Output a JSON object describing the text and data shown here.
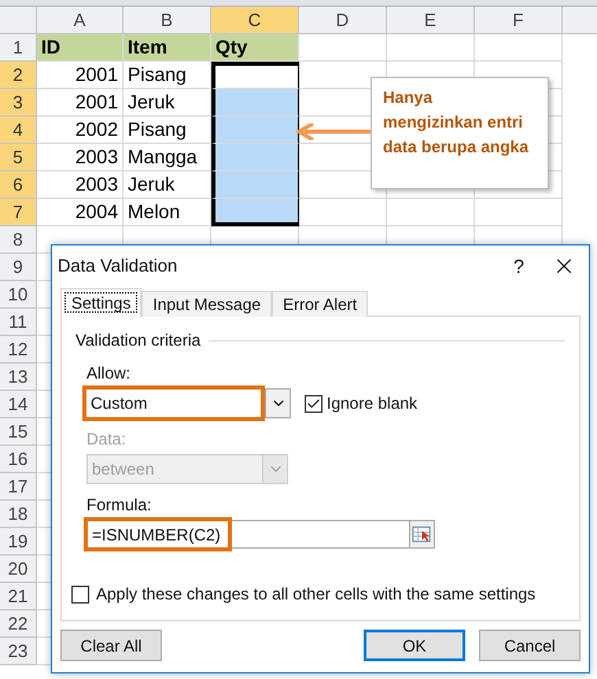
{
  "sheet": {
    "columns": [
      {
        "label": "A",
        "selected": false
      },
      {
        "label": "B",
        "selected": false
      },
      {
        "label": "C",
        "selected": true
      },
      {
        "label": "D",
        "selected": false
      },
      {
        "label": "E",
        "selected": false
      },
      {
        "label": "F",
        "selected": false
      }
    ],
    "header_row": {
      "label": "1",
      "cells": [
        "ID",
        "Item",
        "Qty"
      ]
    },
    "rows": [
      {
        "label": "2",
        "selected": true,
        "active": true,
        "id": "2001",
        "item": "Pisang"
      },
      {
        "label": "3",
        "selected": true,
        "active": false,
        "id": "2001",
        "item": "Jeruk"
      },
      {
        "label": "4",
        "selected": true,
        "active": false,
        "id": "2002",
        "item": "Pisang"
      },
      {
        "label": "5",
        "selected": true,
        "active": false,
        "id": "2003",
        "item": "Mangga"
      },
      {
        "label": "6",
        "selected": true,
        "active": false,
        "id": "2003",
        "item": "Jeruk"
      },
      {
        "label": "7",
        "selected": true,
        "active": false,
        "id": "2004",
        "item": "Melon"
      }
    ],
    "empty_rows": [
      "8",
      "9",
      "10",
      "11",
      "12",
      "13",
      "14",
      "15",
      "16",
      "17",
      "18",
      "19",
      "20",
      "21",
      "22",
      "23"
    ]
  },
  "callout": {
    "text": "Hanya mengizinkan entri data berupa angka"
  },
  "dialog": {
    "title": "Data Validation",
    "help": "?",
    "tabs": [
      {
        "label": "Settings",
        "selected": true
      },
      {
        "label": "Input Message",
        "selected": false
      },
      {
        "label": "Error Alert",
        "selected": false
      }
    ],
    "group": "Validation criteria",
    "allow": {
      "label": "Allow:",
      "value": "Custom",
      "highlighted": true
    },
    "ignore_blank": {
      "label": "Ignore blank",
      "checked": true
    },
    "data": {
      "label": "Data:",
      "value": "between",
      "disabled": true
    },
    "formula": {
      "label": "Formula:",
      "value": "=ISNUMBER(C2)",
      "highlighted": true
    },
    "apply_all": {
      "label": "Apply these changes to all other cells with the same settings",
      "checked": false
    },
    "buttons": [
      {
        "label": "Clear All",
        "default": false
      },
      {
        "label": "OK",
        "default": true
      },
      {
        "label": "Cancel",
        "default": false
      }
    ]
  }
}
